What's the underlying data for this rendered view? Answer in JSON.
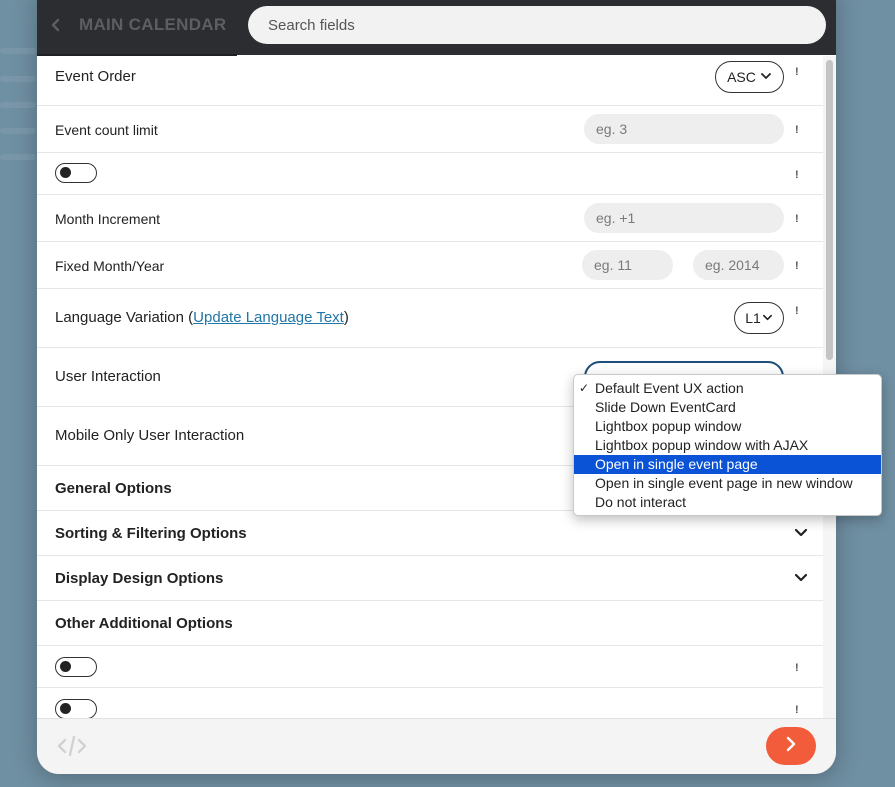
{
  "header": {
    "title": "MAIN CALENDAR",
    "search_placeholder": "Search fields"
  },
  "rows": {
    "event_order": {
      "label": "Event Order",
      "value": "ASC"
    },
    "event_count": {
      "label": "Event count limit",
      "placeholder": "eg. 3"
    },
    "month_increment": {
      "label": "Month Increment",
      "placeholder": "eg. +1"
    },
    "fixed_month_year": {
      "label": "Fixed Month/Year",
      "month_placeholder": "eg. 11",
      "year_placeholder": "eg. 2014"
    },
    "language": {
      "label_prefix": "Language Variation (",
      "link": "Update Language Text",
      "label_suffix": ")",
      "value": "L1"
    },
    "user_interaction": {
      "label": "User Interaction"
    },
    "mobile_interaction": {
      "label": "Mobile Only User Interaction"
    }
  },
  "info_mark": "!",
  "sections": [
    {
      "label": "General Options"
    },
    {
      "label": "Sorting & Filtering Options"
    },
    {
      "label": "Display Design Options"
    },
    {
      "label": "Other Additional Options"
    }
  ],
  "dropdown": {
    "items": [
      {
        "label": "Default Event UX action",
        "checked": true
      },
      {
        "label": "Slide Down EventCard"
      },
      {
        "label": "Lightbox popup window"
      },
      {
        "label": "Lightbox popup window with AJAX"
      },
      {
        "label": "Open in single event page",
        "highlighted": true
      },
      {
        "label": "Open in single event page in new window"
      },
      {
        "label": "Do not interact"
      }
    ],
    "check_mark": "✓"
  },
  "colors": {
    "header_bg": "#2b2d30",
    "accent_button": "#f25c3a",
    "link": "#2176a8",
    "selection": "#0a52d6"
  },
  "icons": {
    "back": "chevron-left-icon",
    "code": "code-icon",
    "next": "chevron-right-icon",
    "expand": "chevron-down-icon"
  }
}
